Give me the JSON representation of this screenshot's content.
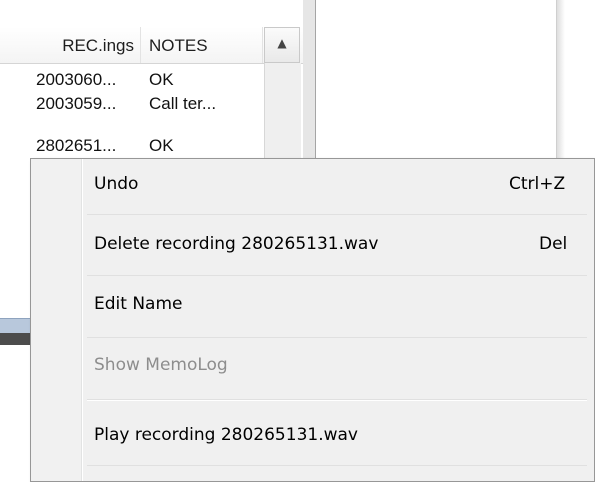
{
  "list": {
    "columns": [
      "REC.ings",
      "NOTES"
    ],
    "rows": [
      {
        "rec": "2003060...",
        "notes": "OK"
      },
      {
        "rec": "2003059...",
        "notes": "Call ter..."
      },
      {
        "rec": "2802651...",
        "notes": "OK"
      }
    ],
    "scroll_up_icon": "triangle-up-icon"
  },
  "context_menu": {
    "items": [
      {
        "label": "Undo",
        "shortcut": "Ctrl+Z",
        "enabled": true
      },
      {
        "label": "Delete recording 280265131.wav",
        "shortcut": "Del",
        "enabled": true
      },
      {
        "label": "Edit Name",
        "shortcut": "",
        "enabled": true
      },
      {
        "label": "Show MemoLog",
        "shortcut": "",
        "enabled": false
      },
      {
        "label": "Play recording 280265131.wav",
        "shortcut": "",
        "enabled": true
      }
    ]
  },
  "colors": {
    "menu_background": "#f0f0f0",
    "disabled_text": "#8d8d8d",
    "menu_border": "#979797"
  }
}
